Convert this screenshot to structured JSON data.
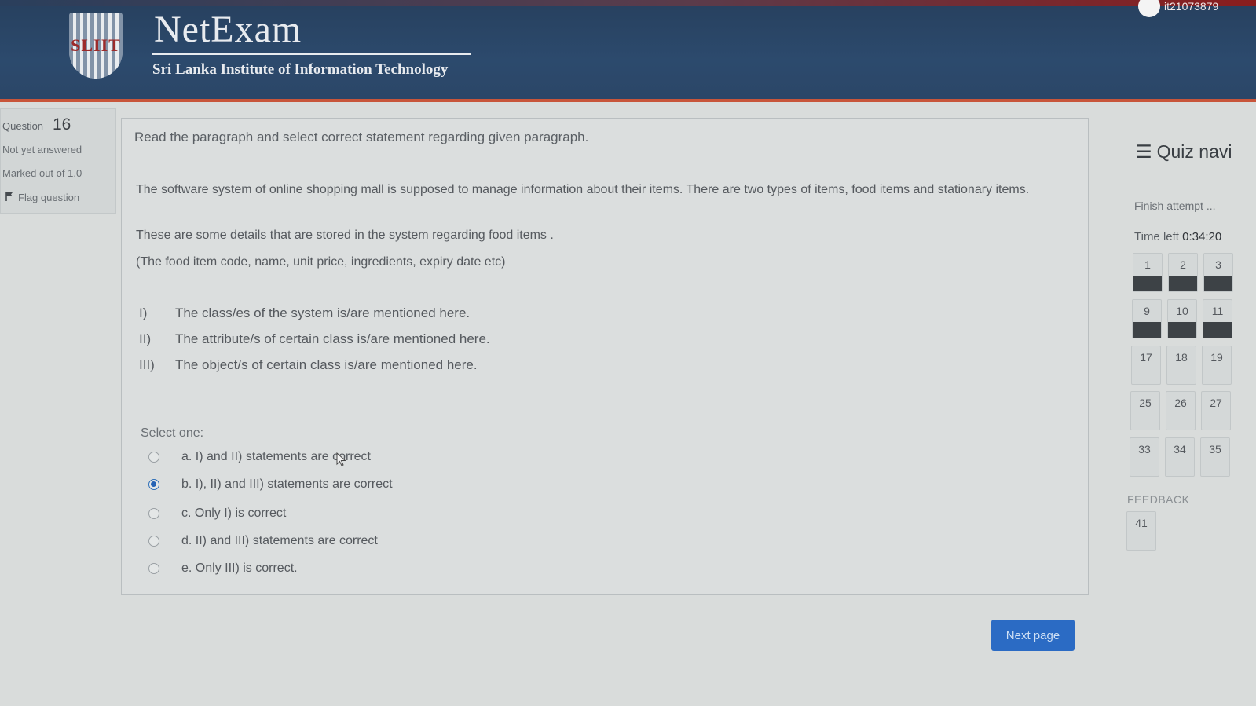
{
  "header": {
    "brand_title": "NetExam",
    "brand_subtitle": "Sri Lanka Institute of Information Technology",
    "logo_text": "SLIIT",
    "user_id": "it21073879"
  },
  "question_info": {
    "label": "Question",
    "number": "16",
    "state": "Not yet answered",
    "marked": "Marked out of 1.0",
    "flag_label": "Flag question"
  },
  "question": {
    "prompt": "Read the paragraph and select correct statement regarding given paragraph.",
    "paragraphs": [
      "The software system of online shopping mall is supposed to manage information about their items. There are two types of items, food items and stationary items.",
      "These are some details that are stored in the system regarding food items .",
      "(The food item code, name, unit price, ingredients, expiry date etc)"
    ],
    "statements": [
      {
        "num": "I)",
        "text": "The class/es of the system is/are mentioned here."
      },
      {
        "num": "II)",
        "text": "The attribute/s of certain class is/are mentioned here."
      },
      {
        "num": "III)",
        "text": "The object/s of certain class is/are mentioned here."
      }
    ],
    "select_one": "Select one:",
    "options": [
      {
        "text": "a. I) and II) statements are correct",
        "checked": false
      },
      {
        "text": "b. I), II) and III) statements are correct",
        "checked": true
      },
      {
        "text": "c. Only I) is correct",
        "checked": false
      },
      {
        "text": "d. II) and III) statements are correct",
        "checked": false
      },
      {
        "text": "e. Only III) is correct.",
        "checked": false
      }
    ]
  },
  "next_button": "Next page",
  "quiz_nav": {
    "title": "Quiz navi",
    "finish": "Finish attempt ...",
    "time_label": "Time left",
    "time_value": "0:34:20",
    "buttons": [
      {
        "n": "1",
        "answered": true
      },
      {
        "n": "2",
        "answered": true
      },
      {
        "n": "3",
        "answered": true
      },
      {
        "n": "9",
        "answered": true
      },
      {
        "n": "10",
        "answered": true
      },
      {
        "n": "11",
        "answered": true
      },
      {
        "n": "17",
        "answered": false
      },
      {
        "n": "18",
        "answered": false
      },
      {
        "n": "19",
        "answered": false
      },
      {
        "n": "25",
        "answered": false
      },
      {
        "n": "26",
        "answered": false
      },
      {
        "n": "27",
        "answered": false
      },
      {
        "n": "33",
        "answered": false
      },
      {
        "n": "34",
        "answered": false
      },
      {
        "n": "35",
        "answered": false
      }
    ],
    "feedback_label": "FEEDBACK",
    "feedback_buttons": [
      {
        "n": "41",
        "answered": false
      }
    ]
  },
  "colors": {
    "header_bg": "#2c4a6d",
    "accent": "#c8553a",
    "primary_button": "#2b6bc4",
    "answered_bar": "#3d4246"
  }
}
